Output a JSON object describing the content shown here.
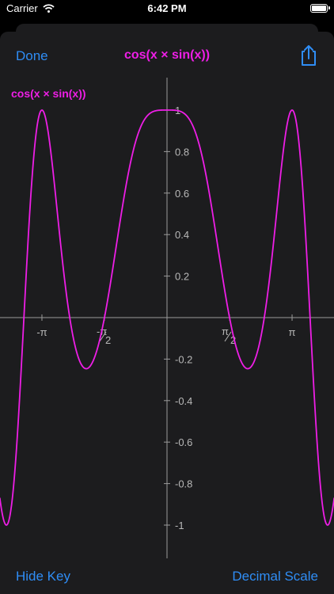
{
  "status_bar": {
    "carrier": "Carrier",
    "time": "6:42 PM"
  },
  "nav": {
    "done_label": "Done",
    "title": "cos(x × sin(x))"
  },
  "plot": {
    "key_label": "cos(x × sin(x))",
    "y_tick_labels": [
      "1",
      "0.8",
      "0.6",
      "0.4",
      "0.2",
      "-0.2",
      "-0.4",
      "-0.6",
      "-0.8",
      "-1"
    ],
    "x_tick_labels": [
      {
        "num": "-π",
        "den": ""
      },
      {
        "num": "-π",
        "den": "2"
      },
      {
        "num": "π",
        "den": "2"
      },
      {
        "num": "π",
        "den": ""
      }
    ]
  },
  "bottom_bar": {
    "hide_key_label": "Hide Key",
    "scale_label": "Decimal Scale"
  },
  "colors": {
    "accent": "#2f8df5",
    "curve": "#ee1ee6",
    "background": "#1c1c1e",
    "axis": "#9a9a9a"
  },
  "icons": {
    "share": "share-icon",
    "wifi": "wifi-icon",
    "battery": "battery-icon"
  },
  "chart_data": {
    "type": "line",
    "function": "cos(x × sin(x))",
    "series": [
      {
        "name": "cos(x × sin(x))"
      }
    ],
    "xlim": [
      -4.2,
      4.2
    ],
    "ylim": [
      -1.15,
      1.1
    ],
    "x_ticks": [
      -3.14159,
      -1.5708,
      1.5708,
      3.14159
    ],
    "y_ticks": [
      1,
      0.8,
      0.6,
      0.4,
      0.2,
      -0.2,
      -0.4,
      -0.6,
      -0.8,
      -1
    ],
    "grid": false
  }
}
